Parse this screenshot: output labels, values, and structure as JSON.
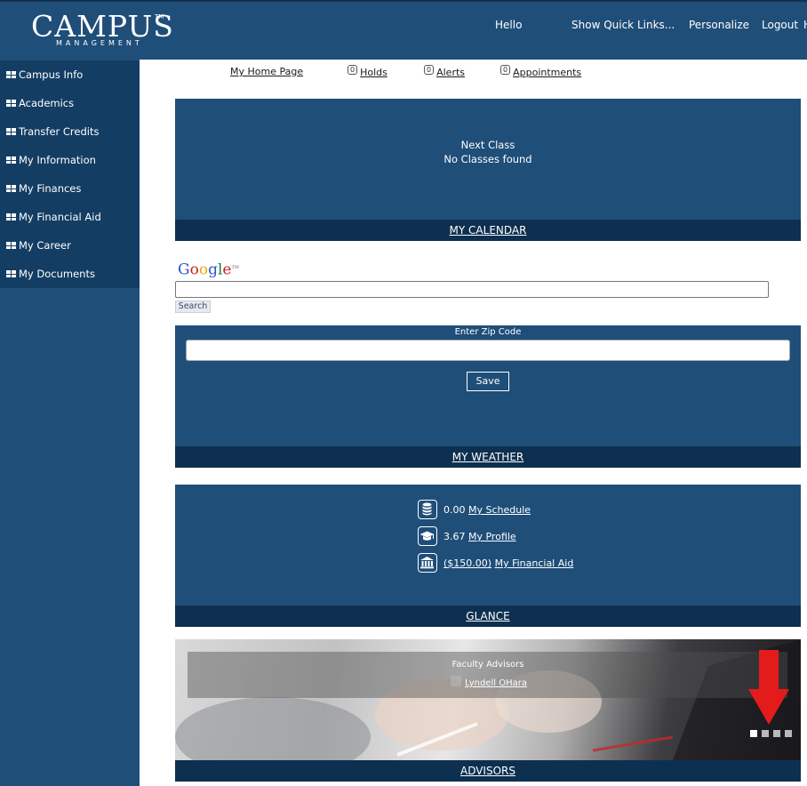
{
  "header": {
    "logo_main": "CAMPUS",
    "logo_tm": "TM",
    "logo_sub": "MANAGEMENT",
    "hello": "Hello",
    "quick_links": "Show Quick Links...",
    "personalize": "Personalize",
    "logout": "Logout",
    "clipped": "H"
  },
  "sidebar": {
    "items": [
      {
        "label": "Campus Info"
      },
      {
        "label": "Academics"
      },
      {
        "label": "Transfer Credits"
      },
      {
        "label": "My Information"
      },
      {
        "label": "My Finances"
      },
      {
        "label": "My Financial Aid"
      },
      {
        "label": "My Career"
      },
      {
        "label": "My Documents"
      }
    ]
  },
  "toplinks": {
    "home": "My Home Page",
    "holds": "Holds",
    "holds_count": "0",
    "alerts": "Alerts",
    "alerts_count": "0",
    "appointments": "Appointments",
    "appointments_count": "0"
  },
  "calendar": {
    "next_class": "Next Class",
    "no_classes": "No Classes found",
    "footer": "MY CALENDAR"
  },
  "google": {
    "logo": "Google",
    "search_button": "Search"
  },
  "weather": {
    "zip_label": "Enter Zip Code",
    "save_button": "Save",
    "footer": "MY WEATHER"
  },
  "glance": {
    "rows": [
      {
        "value": "0.00",
        "link": "My Schedule",
        "icon": "database-icon"
      },
      {
        "value": "3.67",
        "link": "My Profile",
        "icon": "graduation-cap-icon"
      },
      {
        "value": "($150.00)",
        "link": "My Financial Aid",
        "icon": "bank-icon"
      }
    ],
    "footer": "GLANCE"
  },
  "advisors": {
    "title": "Faculty Advisors",
    "name": "Lyndell OHara",
    "footer": "ADVISORS",
    "active_slide": 1,
    "slide_count": 4
  },
  "colors": {
    "header_bg": "#1f4e79",
    "panel_bg": "#1f4e79",
    "panel_footer": "#0e3050",
    "arrow": "#e31b1b"
  }
}
